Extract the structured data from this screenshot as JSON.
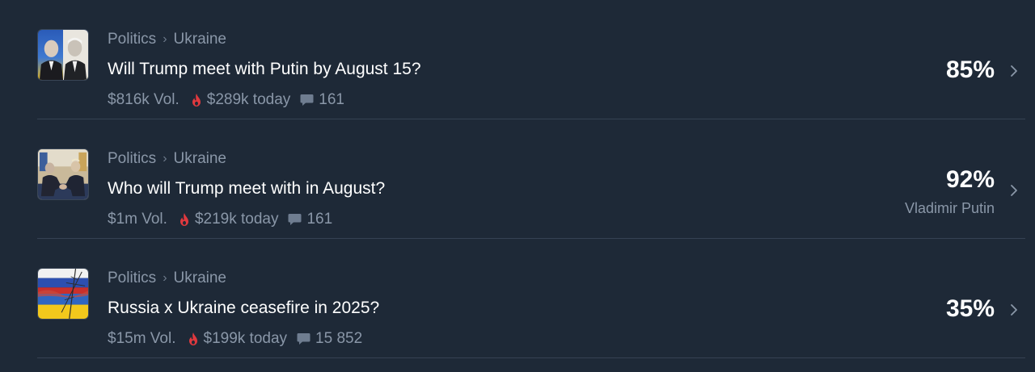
{
  "colors": {
    "background": "#1e2937",
    "muted_text": "#8a97a8",
    "fire": "#e0393e",
    "divider": "#364253"
  },
  "markets": [
    {
      "category": "Politics",
      "subcategory": "Ukraine",
      "title": "Will Trump meet with Putin by August 15?",
      "volume": "$816k Vol.",
      "today": "$289k today",
      "comments": "161",
      "percent": "85%",
      "leader": "",
      "thumbnail": "portraits-image"
    },
    {
      "category": "Politics",
      "subcategory": "Ukraine",
      "title": "Who will Trump meet with in August?",
      "volume": "$1m Vol.",
      "today": "$219k today",
      "comments": "161",
      "percent": "92%",
      "leader": "Vladimir Putin",
      "thumbnail": "handshake-image"
    },
    {
      "category": "Politics",
      "subcategory": "Ukraine",
      "title": "Russia x Ukraine ceasefire in 2025?",
      "volume": "$15m Vol.",
      "today": "$199k today",
      "comments": "15 852",
      "percent": "35%",
      "leader": "",
      "thumbnail": "flags-image"
    }
  ],
  "icons": {
    "breadcrumb_separator": "chevron-right-icon",
    "trending": "fire-icon",
    "comments": "comment-icon",
    "row_arrow": "chevron-right-icon"
  }
}
